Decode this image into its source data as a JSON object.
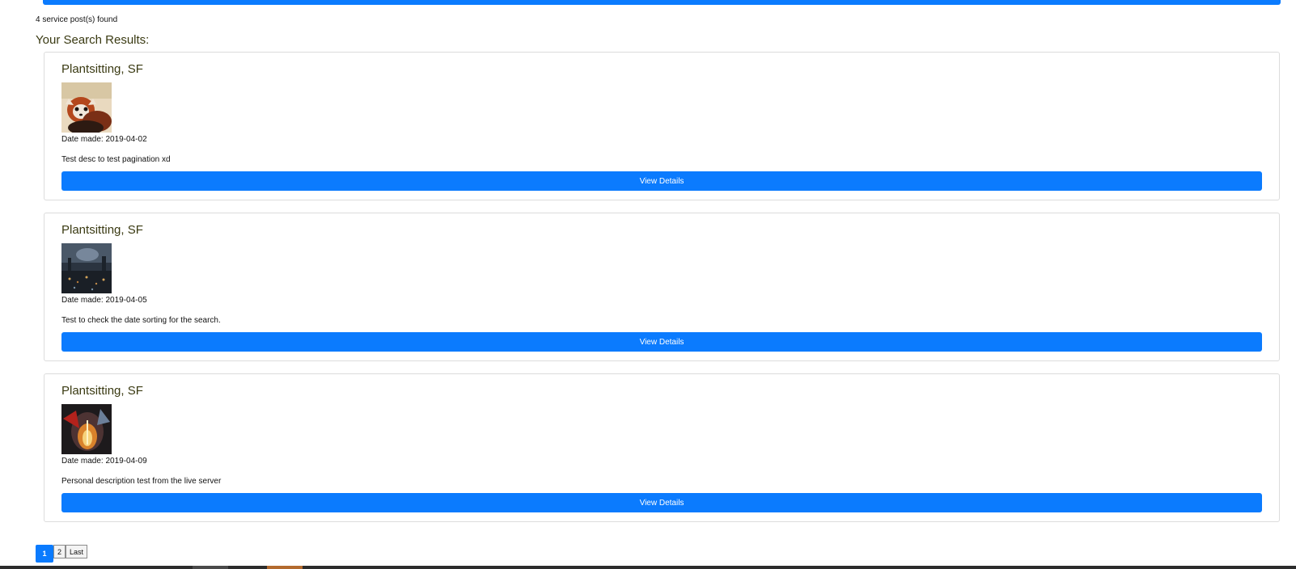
{
  "results": {
    "found_text": "4 service post(s) found",
    "title": "Your Search Results:"
  },
  "posts": [
    {
      "title": "Plantsitting, SF",
      "date_text": "Date made: 2019-04-02",
      "description": "Test desc to test pagination xd",
      "button_label": "View Details",
      "image": "red-panda-photo"
    },
    {
      "title": "Plantsitting, SF",
      "date_text": "Date made: 2019-04-05",
      "description": "Test to check the date sorting for the search.",
      "button_label": "View Details",
      "image": "dark-city-crowd-photo"
    },
    {
      "title": "Plantsitting, SF",
      "date_text": "Date made: 2019-04-09",
      "description": "Personal description test from the live server",
      "button_label": "View Details",
      "image": "fiery-abstract-artwork"
    }
  ],
  "pagination": {
    "pages": [
      "1",
      "2"
    ],
    "last_label": "Last",
    "current": "1"
  },
  "colors": {
    "accent": "#0b7bfe",
    "title_text": "#3a3a12"
  }
}
